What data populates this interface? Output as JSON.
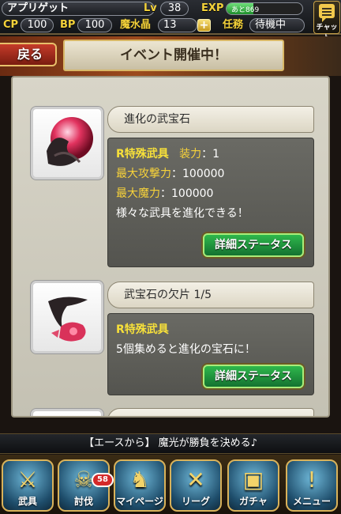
{
  "status": {
    "player_name": "アプリゲット",
    "lv_label": "Lv",
    "lv_value": "38",
    "exp_label": "EXP",
    "exp_text": "あと869",
    "exp_fraction": 0.35,
    "cp_label": "CP",
    "cp_value": "100",
    "bp_label": "BP",
    "bp_value": "100",
    "magic_label": "魔水晶",
    "magic_value": "13",
    "plus_label": "+",
    "task_label": "任務",
    "task_value": "待機中",
    "chat_label": "チャット"
  },
  "header": {
    "back_label": "戻る",
    "title": "イベント開催中！"
  },
  "items": [
    {
      "name": "進化の武宝石",
      "rarity": "R特殊武具",
      "equip_label": "装力",
      "equip_value": "：1",
      "atk_label": "最大攻撃力",
      "atk_value": "：100000",
      "mag_label": "最大魔力",
      "mag_value": "：100000",
      "desc": "様々な武具を進化できる！",
      "button": "詳細ステータス"
    },
    {
      "name": "武宝石の欠片 1/5",
      "rarity": "R特殊武具",
      "desc": "5個集めると進化の宝石に！",
      "button": "詳細ステータス"
    }
  ],
  "ticker": "【エースから】 魔光が勝負を決める♪",
  "nav": {
    "weapons": "武具",
    "subjugation": "討伐",
    "mypage": "マイページ",
    "league": "リーグ",
    "gacha": "ガチャ",
    "menu": "メニュー",
    "badge": "58"
  }
}
